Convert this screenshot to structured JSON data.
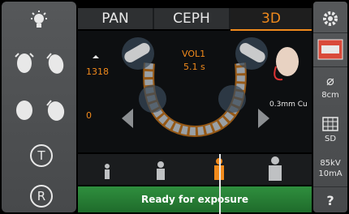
{
  "tabs": [
    {
      "label": "PAN",
      "selected": false
    },
    {
      "label": "CEPH",
      "selected": false
    },
    {
      "label": "3D",
      "selected": true
    }
  ],
  "volume": {
    "name": "VOL1",
    "time": "5.1 s"
  },
  "position": {
    "upper": "1318",
    "lower": "0"
  },
  "filter": {
    "label": "0.3mm Cu"
  },
  "right_panel": {
    "fov_value": "8cm",
    "resolution_label": "SD",
    "exposure_kv": "85kV",
    "exposure_ma": "10mA",
    "help_label": "?"
  },
  "left_panel": {
    "t_label": "T",
    "r_label": "R"
  },
  "status": {
    "text": "Ready for exposure"
  },
  "colors": {
    "accent": "#f08a1c",
    "status_bg": "#2f8f3e",
    "panel": "#525456"
  }
}
